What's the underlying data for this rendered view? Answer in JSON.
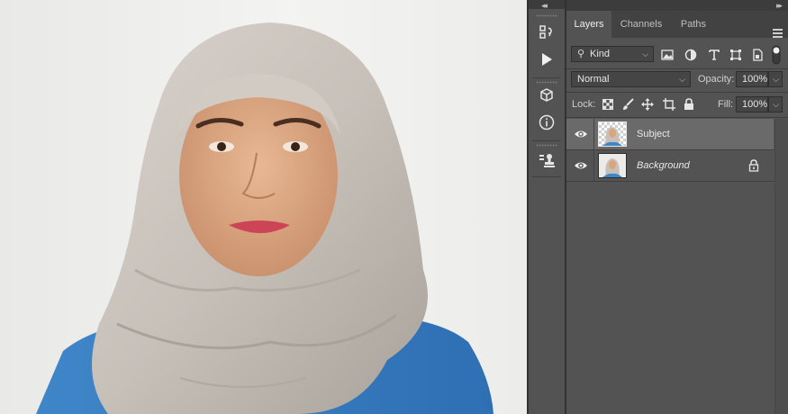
{
  "panel": {
    "tabs": [
      {
        "label": "Layers",
        "active": true
      },
      {
        "label": "Channels",
        "active": false
      },
      {
        "label": "Paths",
        "active": false
      }
    ],
    "filter": {
      "value": "Kind"
    },
    "blend_mode": {
      "value": "Normal"
    },
    "opacity": {
      "label": "Opacity:",
      "value": "100%"
    },
    "lock": {
      "label": "Lock:"
    },
    "fill": {
      "label": "Fill:",
      "value": "100%"
    },
    "layers": [
      {
        "name": "Subject",
        "visible": true,
        "selected": true,
        "transparent": true
      },
      {
        "name": "Background",
        "visible": true,
        "selected": false,
        "locked": true
      }
    ]
  },
  "icons": {
    "strip": [
      "history-icon",
      "play-actions-icon",
      "3d-cube-icon",
      "info-icon",
      "clone-stamp-icon"
    ],
    "filters": [
      "pixel-filter-icon",
      "adjustment-filter-icon",
      "type-filter-icon",
      "shape-filter-icon",
      "smart-object-filter-icon",
      "filter-toggle-icon"
    ],
    "locks": [
      "lock-transparent-icon",
      "lock-brush-icon",
      "lock-move-icon",
      "lock-artboard-icon",
      "lock-all-icon"
    ]
  },
  "colors": {
    "panel_bg": "#535353",
    "tab_bar": "#424242",
    "selected_layer": "#6a6a6a",
    "canvas_bg": "#efefed"
  }
}
